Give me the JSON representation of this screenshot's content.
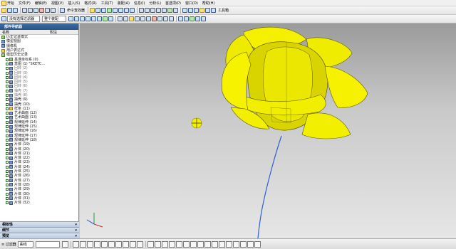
{
  "menubar": {
    "items": [
      "文件(F)",
      "编辑(E)",
      "视图(V)",
      "插入(S)",
      "格式(R)",
      "工具(T)",
      "装配(A)",
      "信息(I)",
      "分析(L)",
      "首选项(P)",
      "窗口(O)",
      "帮助(H)"
    ],
    "start_label": "开始",
    "command_finder": "命令查找器",
    "toolbox": "工具箱"
  },
  "toolbar2": {
    "filter_label": "没有选择过滤器",
    "assembly_label": "整个装配"
  },
  "navigator": {
    "title": "部件导航器",
    "col_name": "名称",
    "col_attr": "附注",
    "tree": [
      {
        "label": "历史记录模式"
      },
      {
        "label": "模型视图"
      },
      {
        "label": "摄像机"
      },
      {
        "label": "用户表达式"
      },
      {
        "label": "模型历史记录"
      },
      {
        "label": "基准坐标系 (0)"
      },
      {
        "label": "草图 (1) \"SKETC..."
      },
      {
        "label": "回转 (2)"
      },
      {
        "label": "回转 (3)"
      },
      {
        "label": "回转 (4)"
      },
      {
        "label": "回转 (5)"
      },
      {
        "label": "回转 (6)"
      },
      {
        "label": "抽壳 (7)"
      },
      {
        "label": "抽壳 (8)"
      },
      {
        "label": "抽壳 (9)"
      },
      {
        "label": "抽壳 (10)"
      },
      {
        "label": "样条 (11)"
      },
      {
        "label": "艺术曲面 (12)"
      },
      {
        "label": "艺术曲面 (13)"
      },
      {
        "label": "规律延伸 (14)"
      },
      {
        "label": "规律延伸 (15)"
      },
      {
        "label": "规律延伸 (16)"
      },
      {
        "label": "规律延伸 (17)"
      },
      {
        "label": "规律延伸 (18)"
      },
      {
        "label": "片体 (19)"
      },
      {
        "label": "片体 (20)"
      },
      {
        "label": "片体 (21)"
      },
      {
        "label": "片体 (22)"
      },
      {
        "label": "片体 (23)"
      },
      {
        "label": "片体 (24)"
      },
      {
        "label": "片体 (25)"
      },
      {
        "label": "片体 (26)"
      },
      {
        "label": "片体 (27)"
      },
      {
        "label": "片体 (28)"
      },
      {
        "label": "片体 (29)"
      },
      {
        "label": "片体 (30)"
      },
      {
        "label": "片体 (31)"
      },
      {
        "label": "片体 (32)"
      }
    ],
    "sections": [
      {
        "label": "相依性"
      },
      {
        "label": "细节"
      },
      {
        "label": "预览"
      }
    ]
  },
  "statusbar": {
    "label_left": "≡ 过滤器",
    "snap_value": "曲线",
    "field_value": ""
  }
}
